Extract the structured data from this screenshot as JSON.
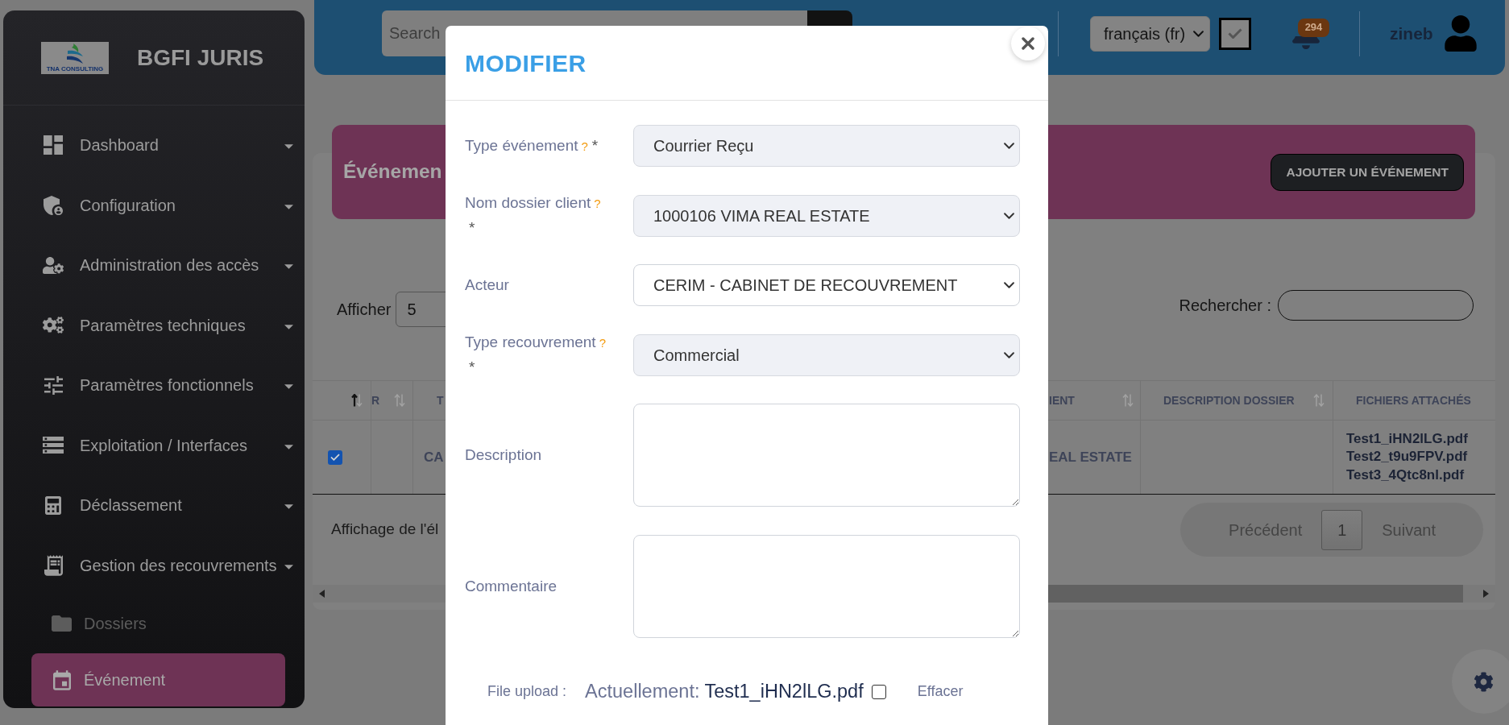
{
  "sidebar": {
    "logo_text": "TNA CONSULTING",
    "title": "BGFI JURIS",
    "items": [
      {
        "label": "Dashboard",
        "selected": false
      },
      {
        "label": "Configuration",
        "selected": false
      },
      {
        "label": "Administration des accès",
        "selected": false
      },
      {
        "label": "Paramètres techniques",
        "selected": false
      },
      {
        "label": "Paramètres fonctionnels",
        "selected": false
      },
      {
        "label": "Exploitation / Interfaces",
        "selected": false
      },
      {
        "label": "Déclassement",
        "selected": false
      },
      {
        "label": "Gestion des recouvrements",
        "selected": false,
        "children": [
          {
            "label": "Dossiers",
            "selected": false
          },
          {
            "label": "Événement",
            "selected": true
          }
        ]
      }
    ]
  },
  "topbar": {
    "search": {
      "placeholder": "Search"
    },
    "language": "français (fr)",
    "toggle": {
      "checked": true
    },
    "notification_count": "294",
    "user_name": "zineb"
  },
  "page": {
    "title": "Événemen",
    "add_button": "AJOUTER UN ÉVÉNEMENT",
    "length_label": "Afficher",
    "length_value": "5",
    "search_label": "Rechercher :"
  },
  "table": {
    "columns": [
      {
        "sorted": true
      },
      {
        "label": "R",
        "sorted": false
      },
      {
        "label": "T"
      },
      {
        "label": "IENT",
        "sorted": false
      },
      {
        "label": "DESCRIPTION DOSSIER",
        "sorted": false
      },
      {
        "label": "FICHIERS ATTACHÉS"
      }
    ],
    "rows": [
      {
        "cells": [
          {
            "kind": "checkbox",
            "checked": true
          },
          {
            "kind": "empty"
          },
          {
            "kind": "text",
            "text": "CA"
          },
          {
            "kind": "text",
            "text": "EAL ESTATE"
          },
          {
            "kind": "empty"
          },
          {
            "kind": "files",
            "files": [
              "Test1_iHN2lLG.pdf",
              "Test2_t9u9FPV.pdf",
              "Test3_4Qtc8nl.pdf"
            ]
          }
        ]
      }
    ]
  },
  "table_footer": {
    "info": "Affichage de l'él",
    "pagination": {
      "previous": "Précédent",
      "pages": [
        {
          "label": "1",
          "selected": true
        }
      ],
      "next": "Suivant"
    }
  },
  "modal": {
    "title": "MODIFIER",
    "fields": [
      {
        "kind": "select",
        "label": "Type événement",
        "help": "?",
        "required_mark": "*",
        "value": "Courrier Reçu",
        "disabled": true
      },
      {
        "kind": "select",
        "label": "Nom dossier client",
        "help": "?",
        "required_mark": "*",
        "value": "1000106 VIMA REAL ESTATE",
        "disabled": true
      },
      {
        "kind": "select",
        "label": "Acteur",
        "value": "CERIM - CABINET DE RECOUVREMENT",
        "disabled": false
      },
      {
        "kind": "select",
        "label": "Type recouvrement",
        "help": "?",
        "required_mark": "*",
        "value": "Commercial",
        "disabled": true
      },
      {
        "kind": "textarea",
        "label": "Description"
      },
      {
        "kind": "textarea",
        "label": "Commentaire"
      }
    ],
    "file_upload": {
      "label": "File upload :",
      "current_label": "Actuellement:",
      "file_name": "Test1_iHN2lLG.pdf",
      "clear_checked": false,
      "clear_label": "Effacer"
    }
  }
}
